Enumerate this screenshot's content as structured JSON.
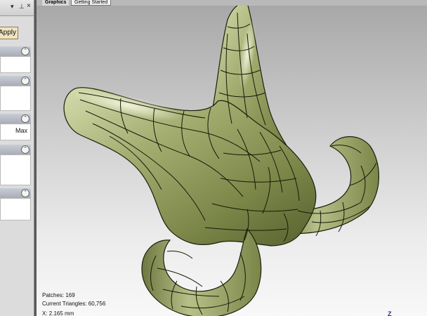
{
  "panel": {
    "pin_glyph": "▾",
    "dock_glyph": "⊥",
    "close_glyph": "×",
    "apply_label": "Apply",
    "collapse_glyph": "⌃",
    "max_label": "Max"
  },
  "tabs": [
    {
      "label": "Graphics"
    },
    {
      "label": "Getting Started"
    }
  ],
  "status": {
    "patches": "Patches: 169",
    "triangles": "Current Triangles: 60,756",
    "coordinate": "X: 2.165 mm"
  },
  "axis_label": "Z",
  "colors": {
    "surface": "#a8b278",
    "surface_highlight": "#eef1d4",
    "surface_shadow": "#4f5a2b",
    "patch_edges": "#151a08"
  }
}
